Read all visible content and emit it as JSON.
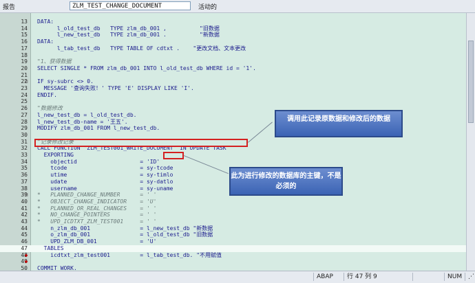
{
  "toolbar": {
    "report_label": "报告",
    "program_name": "ZLM_TEST_CHANGE_DOCUMENT",
    "active_label": "活动的"
  },
  "editor": {
    "lines": [
      {
        "n": "13",
        "text": "DATA:",
        "marker": "",
        "c": false,
        "hl": false
      },
      {
        "n": "14",
        "text": "      l_old_test_db   TYPE zlm_db_001 ,          \"旧数据",
        "marker": "",
        "c": false,
        "hl": false
      },
      {
        "n": "15",
        "text": "      l_new_test_db   TYPE zlm_db_001 .          \"新数据",
        "marker": "",
        "c": false,
        "hl": false
      },
      {
        "n": "16",
        "text": "DATA:",
        "marker": "",
        "c": false,
        "hl": false
      },
      {
        "n": "17",
        "text": "      l_tab_test_db   TYPE TABLE OF cdtxt .    \"更改文档、文本更改",
        "marker": "",
        "c": false,
        "hl": false
      },
      {
        "n": "18",
        "text": "",
        "marker": "",
        "c": false,
        "hl": false
      },
      {
        "n": "19",
        "text": "\"1、获得数据",
        "marker": "",
        "c": true,
        "hl": false
      },
      {
        "n": "20",
        "text": "SELECT SINGLE * FROM zlm_db_001 INTO l_old_test_db WHERE id = '1'.",
        "marker": "",
        "c": false,
        "hl": false
      },
      {
        "n": "21",
        "text": "",
        "marker": "",
        "c": false,
        "hl": false
      },
      {
        "n": "22",
        "text": "IF sy-subrc <> 0.",
        "marker": "⊟",
        "c": false,
        "hl": false
      },
      {
        "n": "23",
        "text": "  MESSAGE '查询失败！' TYPE 'E' DISPLAY LIKE 'I'.",
        "marker": "",
        "c": false,
        "hl": false
      },
      {
        "n": "24",
        "text": "ENDIF.",
        "marker": "",
        "c": false,
        "hl": false
      },
      {
        "n": "25",
        "text": "",
        "marker": "",
        "c": false,
        "hl": false
      },
      {
        "n": "26",
        "text": "\"数据修改",
        "marker": "",
        "c": true,
        "hl": false
      },
      {
        "n": "27",
        "text": "l_new_test_db = l_old_test_db.",
        "marker": "",
        "c": false,
        "hl": false
      },
      {
        "n": "28",
        "text": "l_new_test_db-name = '王五'.",
        "marker": "",
        "c": false,
        "hl": false
      },
      {
        "n": "29",
        "text": "MODIFY zlm_db_001 FROM l_new_test_db.",
        "marker": "",
        "c": false,
        "hl": false
      },
      {
        "n": "30",
        "text": "",
        "marker": "",
        "c": false,
        "hl": false
      },
      {
        "n": "31",
        "text": "\"记录修改记录",
        "marker": "",
        "c": true,
        "hl": false
      },
      {
        "n": "32",
        "text": "CALL FUNCTION 'ZLM_TEST001_WRITE_DOCUMENT' IN UPDATE TASK",
        "marker": "",
        "c": false,
        "hl": false
      },
      {
        "n": "33",
        "text": "  EXPORTING",
        "marker": "",
        "c": false,
        "hl": false
      },
      {
        "n": "34",
        "text": "    objectid                   = 'ID'",
        "marker": "",
        "c": false,
        "hl": false
      },
      {
        "n": "35",
        "text": "    tcode                      = sy-tcode",
        "marker": "",
        "c": false,
        "hl": false
      },
      {
        "n": "36",
        "text": "    utime                      = sy-timlo",
        "marker": "",
        "c": false,
        "hl": false
      },
      {
        "n": "37",
        "text": "    udate                      = sy-datlo",
        "marker": "",
        "c": false,
        "hl": false
      },
      {
        "n": "38",
        "text": "    username                   = sy-uname",
        "marker": "",
        "c": false,
        "hl": false
      },
      {
        "n": "39",
        "text": "*   PLANNED_CHANGE_NUMBER      = ' '",
        "marker": "⊟",
        "c": true,
        "hl": false
      },
      {
        "n": "40",
        "text": "*   OBJECT_CHANGE_INDICATOR    = 'U'",
        "marker": "",
        "c": true,
        "hl": false
      },
      {
        "n": "41",
        "text": "*   PLANNED_OR_REAL_CHANGES    = ' '",
        "marker": "",
        "c": true,
        "hl": false
      },
      {
        "n": "42",
        "text": "*   NO_CHANGE_POINTERS         = ' '",
        "marker": "",
        "c": true,
        "hl": false
      },
      {
        "n": "43",
        "text": "*   UPD_ICDTXT_ZLM_TEST001     = ' '",
        "marker": "",
        "c": true,
        "hl": false
      },
      {
        "n": "44",
        "text": "    n_zlm_db_001               = l_new_test_db \"新数据",
        "marker": "",
        "c": false,
        "hl": false
      },
      {
        "n": "45",
        "text": "    o_zlm_db_001               = l_old_test_db \"旧数据",
        "marker": "",
        "c": false,
        "hl": false
      },
      {
        "n": "46",
        "text": "    UPD_ZLM_DB_001             = 'U'",
        "marker": "",
        "c": false,
        "hl": false
      },
      {
        "n": "47",
        "text": "  TABLES",
        "marker": "",
        "c": false,
        "hl": true
      },
      {
        "n": "48",
        "text": "    icdtxt_zlm_test001         = l_tab_test_db. \"不用赋值",
        "marker": "◆",
        "c": false,
        "hl": false
      },
      {
        "n": "49",
        "text": "",
        "marker": "◆",
        "c": false,
        "hl": false
      },
      {
        "n": "50",
        "text": "COMMIT WORK.",
        "marker": "",
        "c": false,
        "hl": false
      }
    ]
  },
  "annotations": {
    "callout_call": "调用此记录原数据和修改后的数据",
    "callout_objectid": "此为进行修改的数据库的主键，不是必须的"
  },
  "status": {
    "mode": "ABAP",
    "position": "行 47 列  9",
    "num": "NUM"
  },
  "colors": {
    "editor_bg": "#d6ebe3",
    "keyword_blue": "#1a1a8c",
    "highlight_red": "#d42020",
    "callout_blue": "#3b63b4"
  }
}
